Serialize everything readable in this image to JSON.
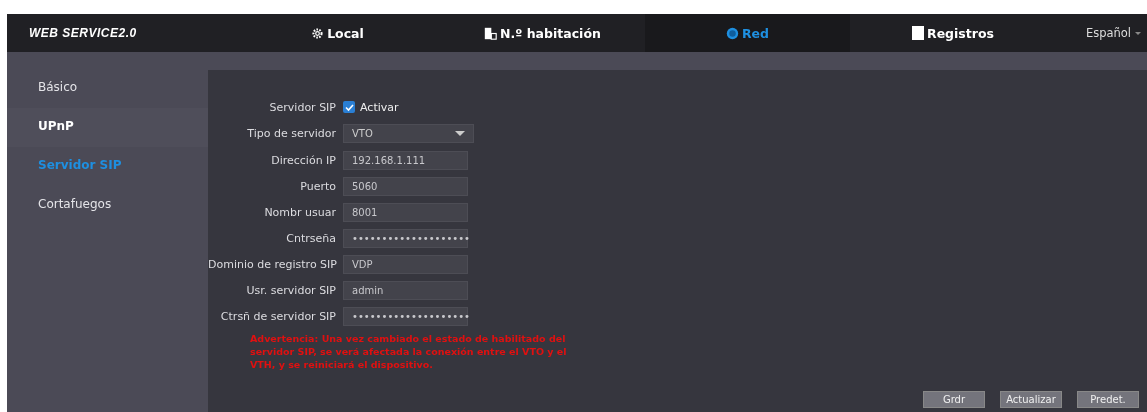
{
  "header": {
    "logo": "WEB SERVICE2.0",
    "tabs": [
      {
        "label": "Local",
        "selected": false
      },
      {
        "label": "N.º habitación",
        "selected": false
      },
      {
        "label": "Red",
        "selected": true
      },
      {
        "label": "Registros",
        "selected": false
      }
    ],
    "language": "Español"
  },
  "sidebar": {
    "items": [
      {
        "label": "Básico",
        "selected": false,
        "hovered": false
      },
      {
        "label": "UPnP",
        "selected": false,
        "hovered": true
      },
      {
        "label": "Servidor SIP",
        "selected": true,
        "hovered": false
      },
      {
        "label": "Cortafuegos",
        "selected": false,
        "hovered": false
      }
    ]
  },
  "form": {
    "fields": [
      {
        "kind": "checkbox",
        "label": "Servidor SIP",
        "option": "Activar",
        "checked": true
      },
      {
        "kind": "select",
        "label": "Tipo de servidor",
        "value": "VTO"
      },
      {
        "kind": "text",
        "label": "Dirección IP",
        "value": "192.168.1.111"
      },
      {
        "kind": "text",
        "label": "Puerto",
        "value": "5060"
      },
      {
        "kind": "text",
        "label": "Nombr usuar",
        "value": "8001"
      },
      {
        "kind": "text",
        "label": "Cntrseña",
        "value": "••••••••••••••••••••"
      },
      {
        "kind": "text",
        "label": "Dominio de registro SIP",
        "value": "VDP"
      },
      {
        "kind": "text",
        "label": "Usr. servidor SIP",
        "value": "admin"
      },
      {
        "kind": "text",
        "label": "Ctrsñ de servidor SIP",
        "value": "••••••••••••••••••••"
      }
    ],
    "warning": "Advertencia: Una vez cambiado el estado de habilitado del servidor SIP, se verá afectada la conexión entre el VTO y el VTH, y se reiniciará el dispositivo.",
    "buttons": [
      "Grdr",
      "Actualizar",
      "Predet."
    ]
  }
}
